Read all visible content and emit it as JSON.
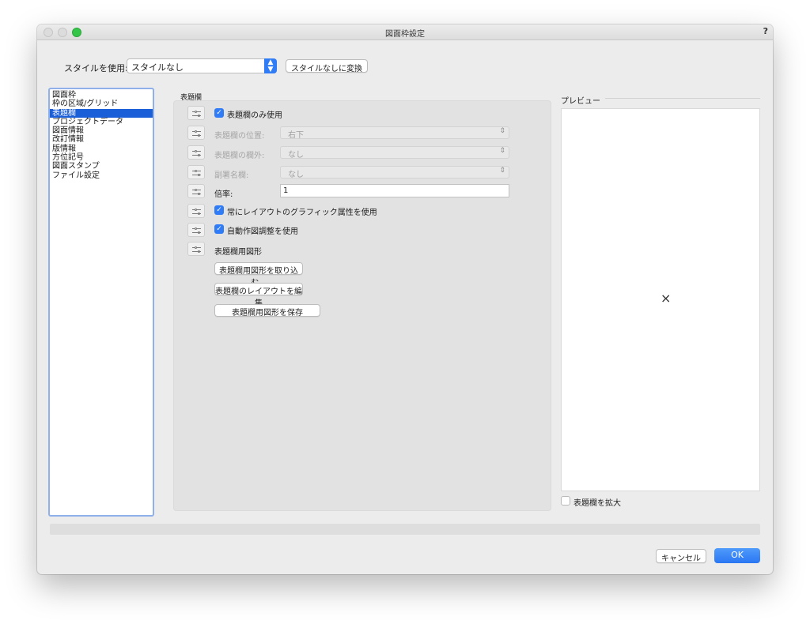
{
  "window": {
    "title": "図面枠設定",
    "help": "?"
  },
  "style": {
    "label": "スタイルを使用:",
    "selected": "スタイルなし",
    "convert_button": "スタイルなしに変換"
  },
  "sidebar": {
    "items": [
      {
        "label": "図面枠",
        "selected": false
      },
      {
        "label": "枠の区域/グリッド",
        "selected": false
      },
      {
        "label": "表題欄",
        "selected": true
      },
      {
        "label": "プロジェクトデータ",
        "selected": false
      },
      {
        "label": "図面情報",
        "selected": false
      },
      {
        "label": "改訂情報",
        "selected": false
      },
      {
        "label": "版情報",
        "selected": false
      },
      {
        "label": "方位記号",
        "selected": false
      },
      {
        "label": "図面スタンプ",
        "selected": false
      },
      {
        "label": "ファイル設定",
        "selected": false
      }
    ]
  },
  "section": {
    "title": "表題欄",
    "only_titleblock": {
      "label": "表題欄のみ使用",
      "checked": true
    },
    "position": {
      "label": "表題欄の位置:",
      "value": "右下"
    },
    "outside": {
      "label": "表題欄の欄外:",
      "value": "なし"
    },
    "subtitle": {
      "label": "副署名欄:",
      "value": "なし"
    },
    "scale": {
      "label": "倍率:",
      "value": "1"
    },
    "always_layout": {
      "label": "常にレイアウトのグラフィック属性を使用",
      "checked": true
    },
    "auto_adjust": {
      "label": "自動作図調整を使用",
      "checked": true
    },
    "shape_label": "表題欄用図形",
    "import_button": "表題欄用図形を取り込む...",
    "edit_layout_button": "表題欄のレイアウトを編集",
    "save_button": "表題欄用図形を保存",
    "check_mark": "✓",
    "chevron": "⌃⌄"
  },
  "preview": {
    "label": "プレビュー",
    "placeholder": "×",
    "expand": {
      "label": "表題欄を拡大",
      "checked": false
    }
  },
  "footer": {
    "cancel": "キャンセル",
    "ok": "OK"
  },
  "colors": {
    "accent": "#2f7cf6",
    "selection": "#1a5ed8",
    "sidebar_border": "#8fb0ea"
  }
}
